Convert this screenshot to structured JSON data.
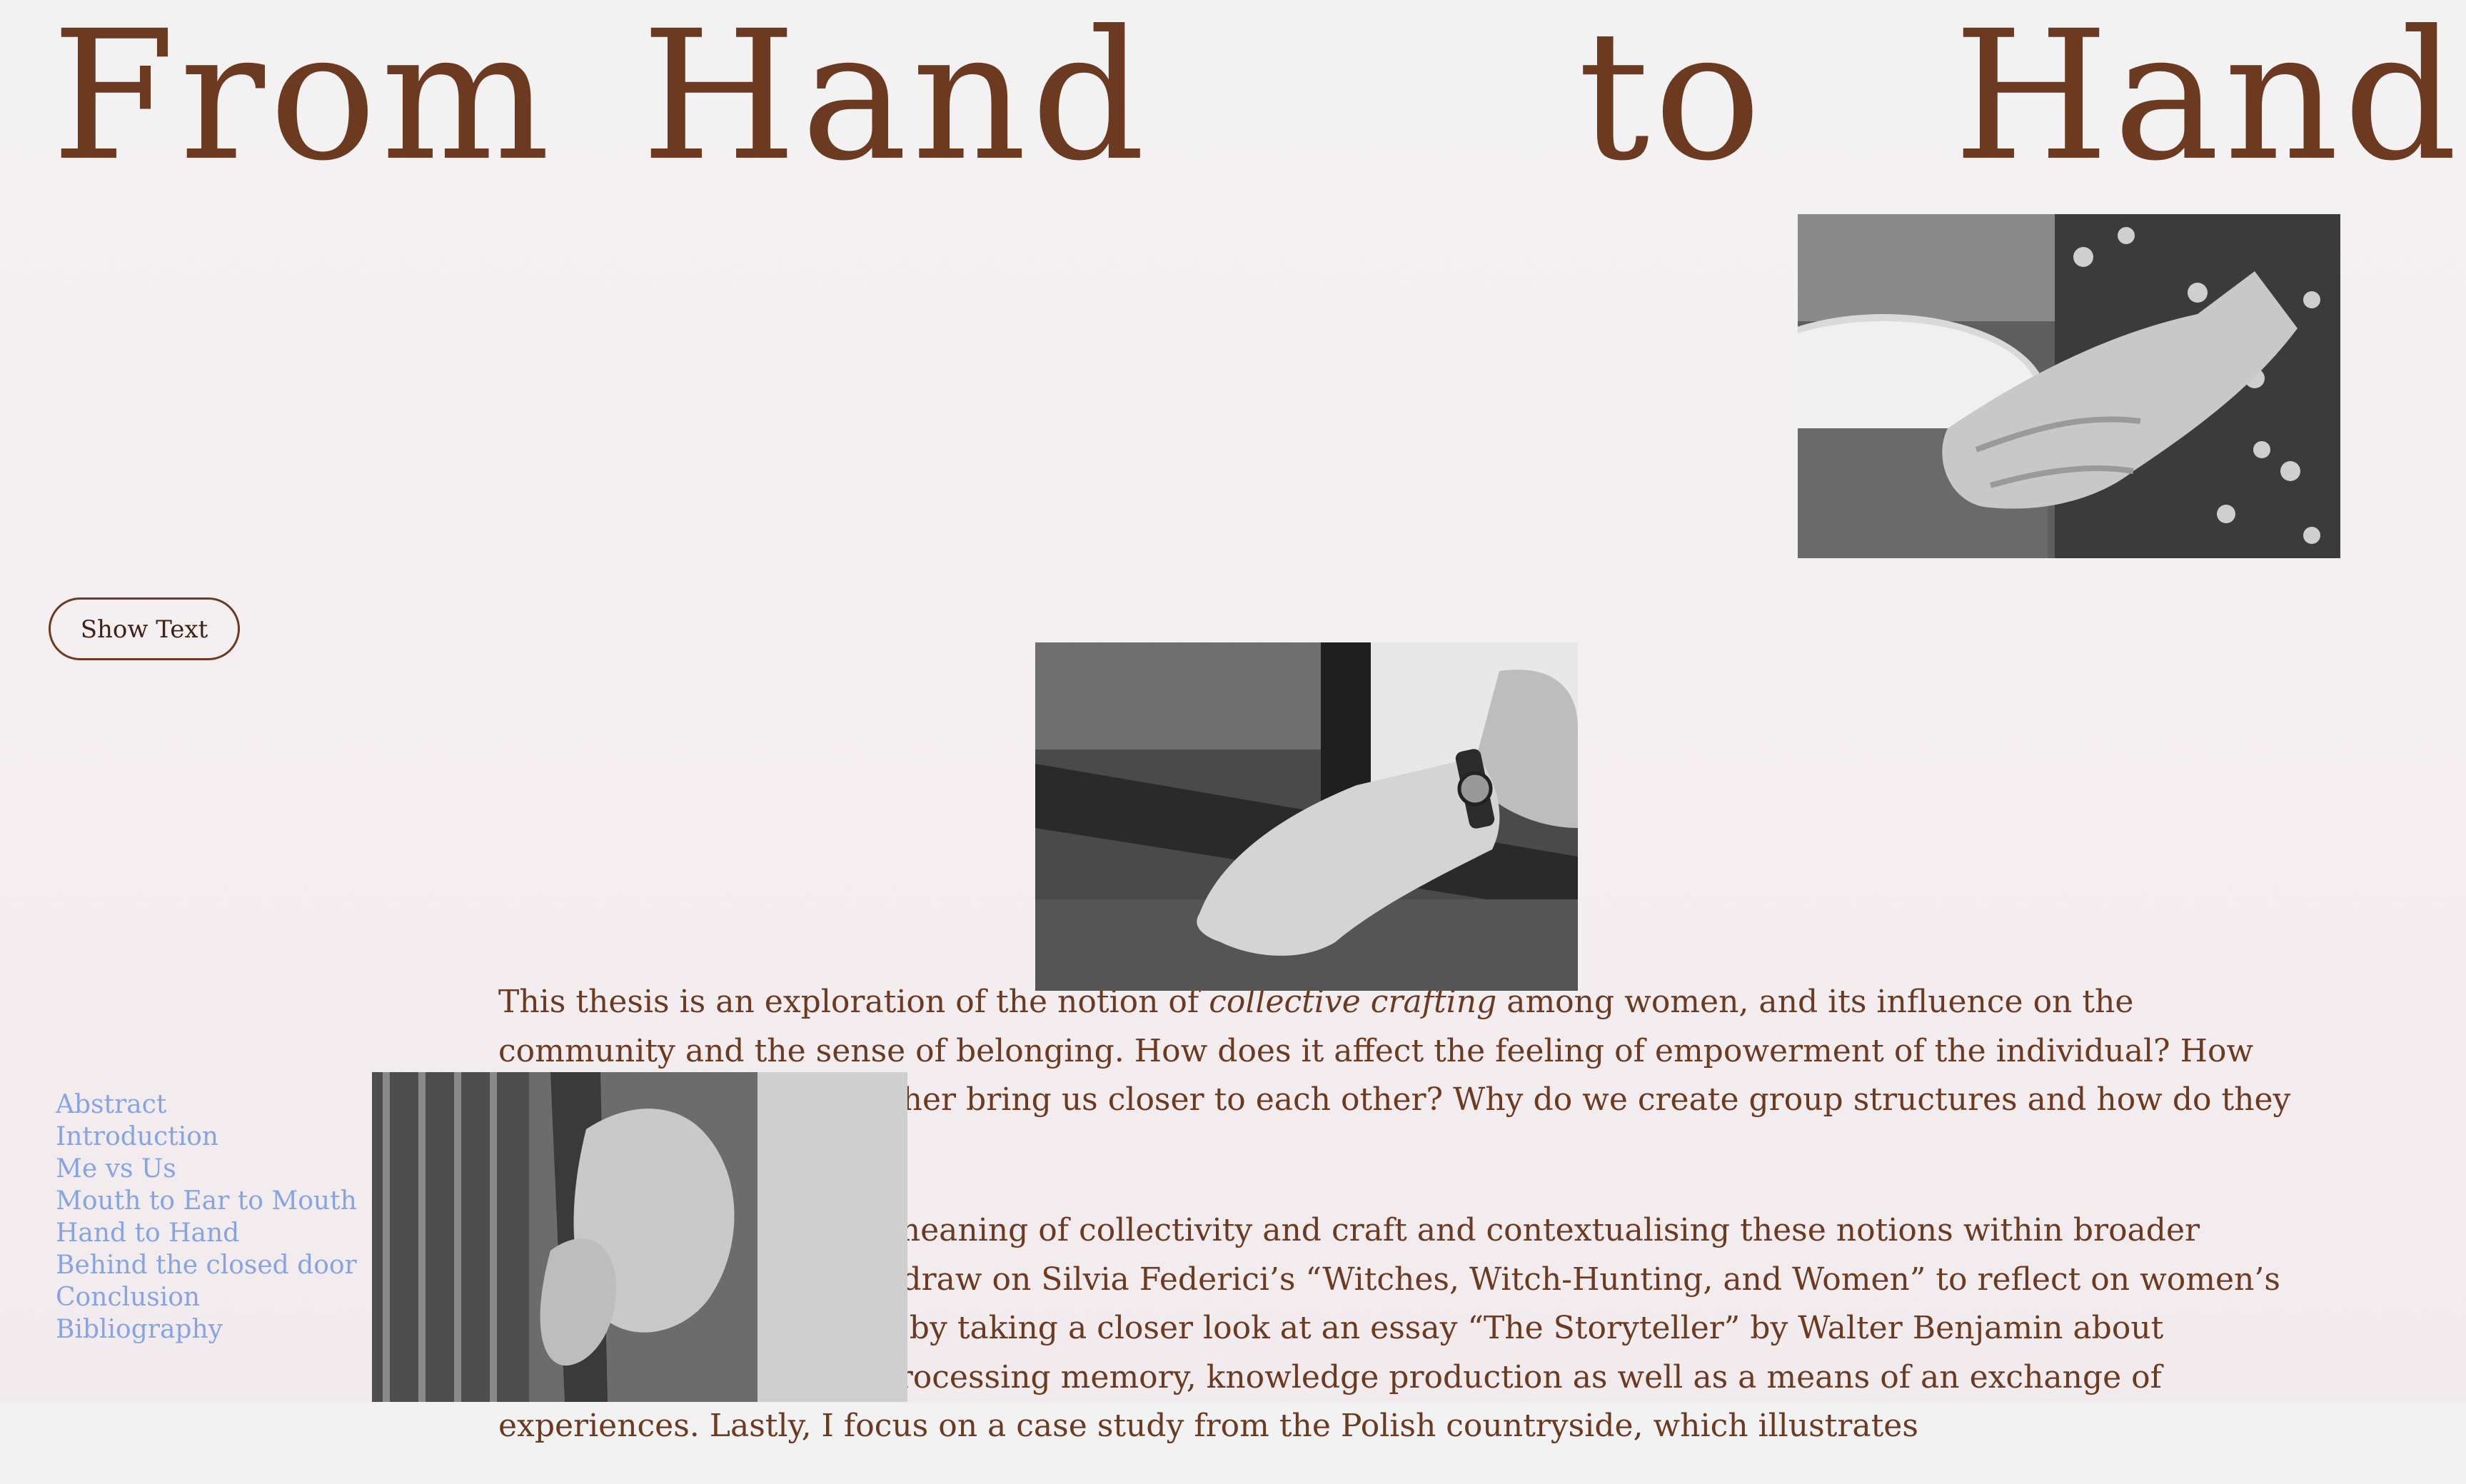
{
  "page": {
    "title_words": [
      "From",
      "Hand",
      "to",
      "Hand"
    ]
  },
  "buttons": {
    "show_text": "Show Text"
  },
  "abstract": {
    "paragraph1": {
      "before": "This thesis is an exploration of the notion of ",
      "emphasis": "collective crafting",
      "after": " among women, and its influence on the community and the sense of belonging. How does it affect the feeling of empowerment of the individual? How does making things together bring us closer to each other? Why do we create group structures and how do they influence us?"
    },
    "paragraph2": "I start by examining the meaning of collectivity and craft and contextualising these notions within broader history. In this process, I draw on Silvia Federici’s “Witches, Witch-Hunting, and Women” to reflect on women’s role in society. I continue by taking a closer look at an essay “The Storyteller” by Walter Benjamin about storytelling as a way of processing memory, knowledge production as well as a means of an exchange of experiences. Lastly, I focus on a case study from the Polish countryside, which illustrates"
  },
  "toc": {
    "items": [
      "Abstract",
      "Introduction",
      "Me vs Us",
      "Mouth to Ear to Mouth",
      "Hand to Hand",
      "Behind the closed door",
      "Conclusion",
      "Bibliography"
    ]
  },
  "images": {
    "hand_on_pot": "black-and-white photo of a hand holding a pot",
    "hand_with_watch": "black-and-white photo of a hand with a wristwatch",
    "hands_holding_stick": "black-and-white photo of hands holding a wooden stick"
  },
  "colors": {
    "title": "#6b3a20",
    "body_text": "#6b3a20",
    "toc_link": "#86a4e3",
    "background": "#f3f0f1"
  }
}
